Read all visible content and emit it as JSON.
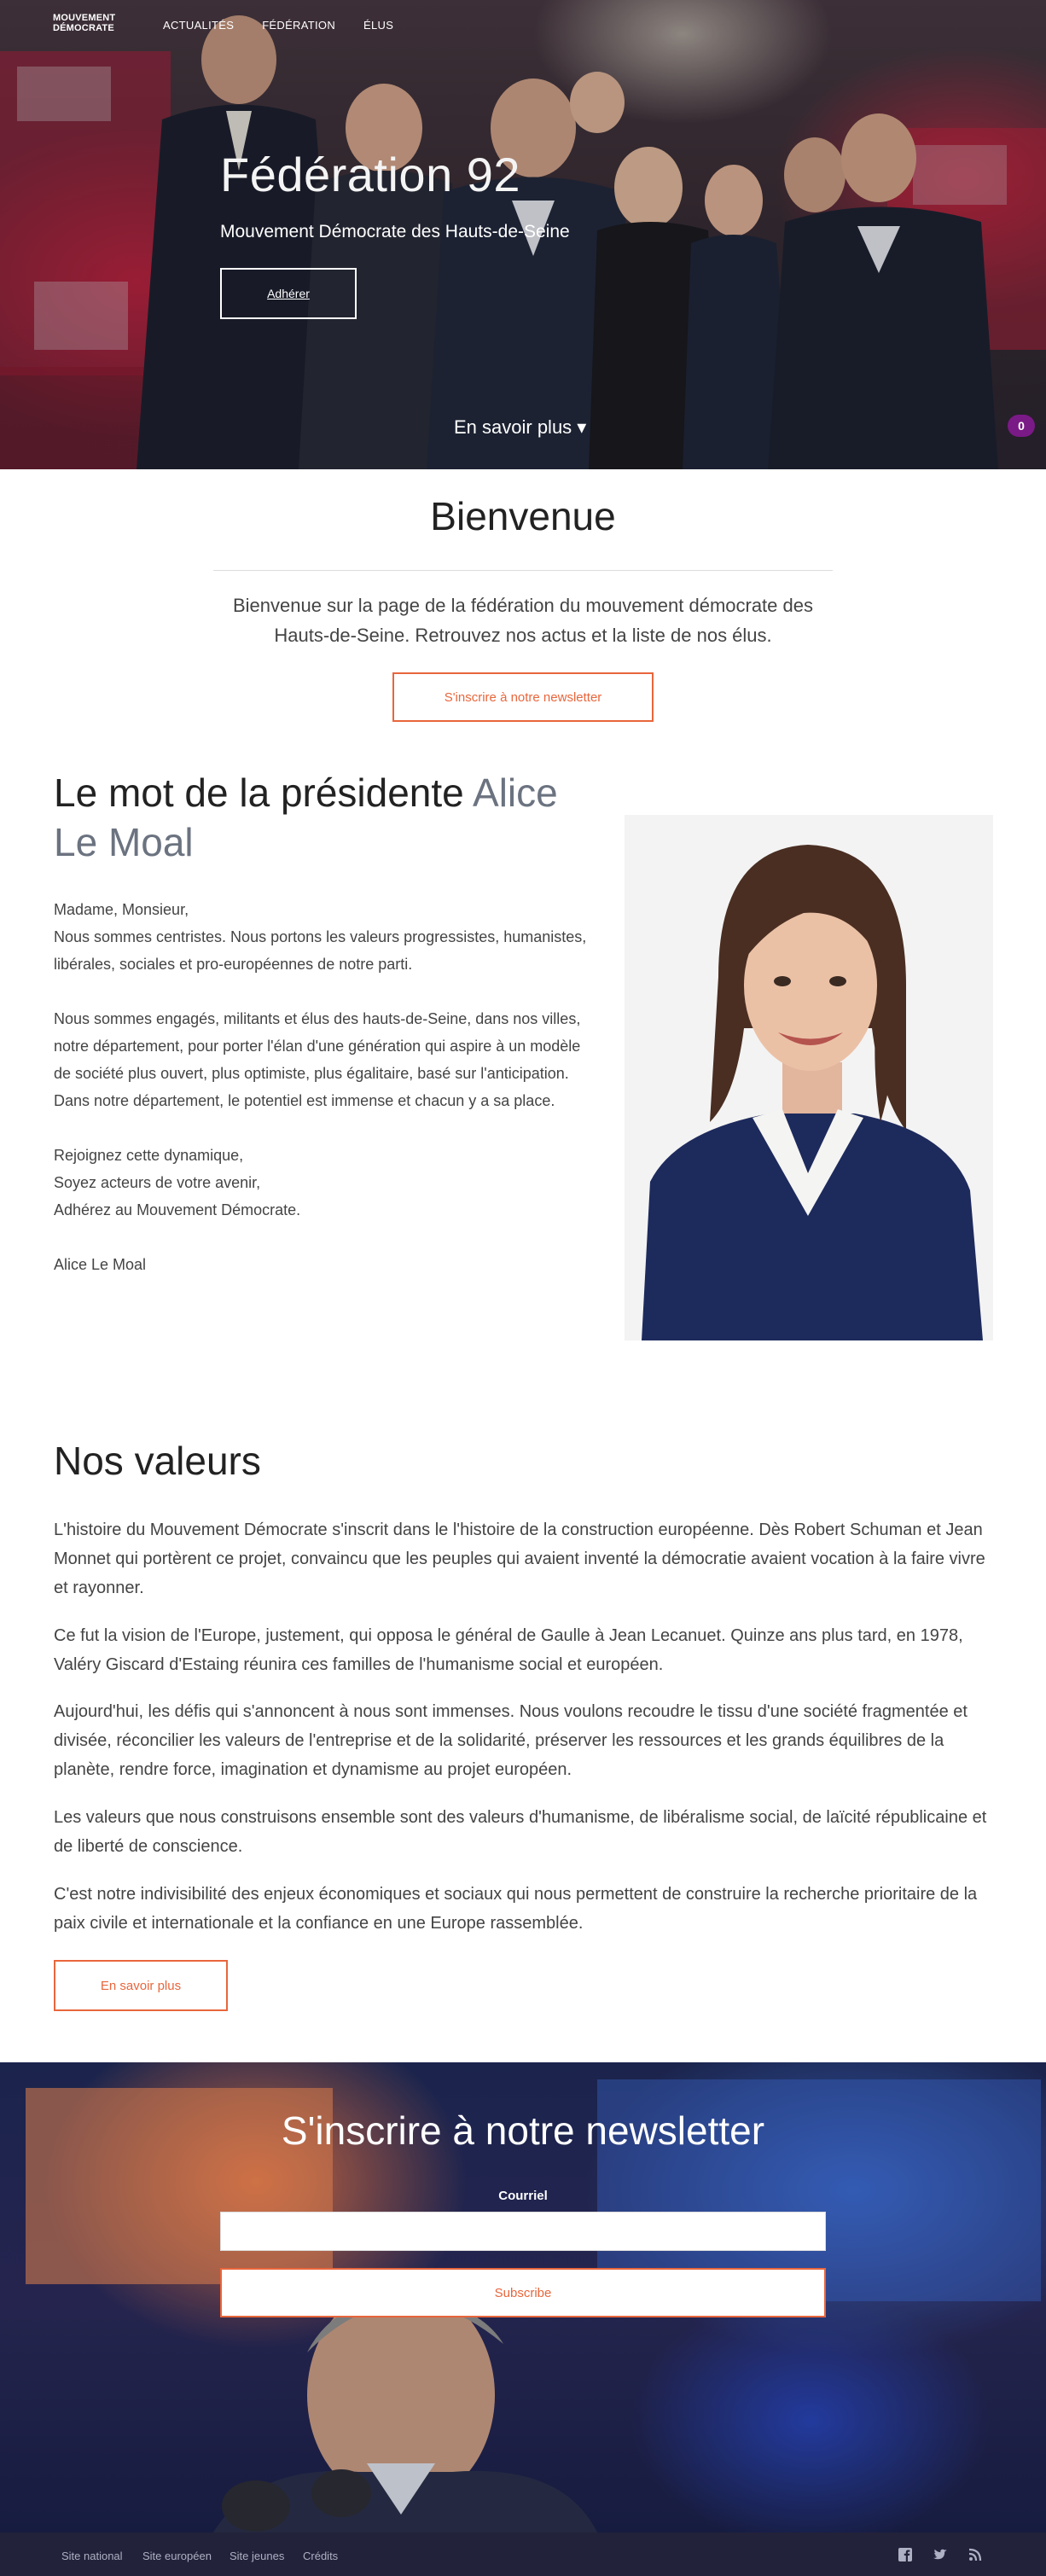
{
  "nav": {
    "logo_line1": "MOUVEMENT",
    "logo_line2": "DÉMOCRATE",
    "items": [
      "ACTUALITÉS",
      "FÉDÉRATION",
      "ÉLUS"
    ]
  },
  "hero": {
    "title": "Fédération 92",
    "subtitle": "Mouvement Démocrate des Hauts-de-Seine",
    "join_button": "Adhérer",
    "more_link": "En savoir plus ▾",
    "badge_count": "0"
  },
  "welcome": {
    "title": "Bienvenue",
    "text": "Bienvenue sur la page de la fédération du mouvement démocrate des Hauts-de-Seine. Retrouvez nos actus et la liste de nos élus.",
    "newsletter_button": "S'inscrire à notre newsletter"
  },
  "president": {
    "title_prefix": "Le mot de la présidente",
    "title_name": "Alice Le Moal",
    "text": "Madame, Monsieur,\nNous sommes centristes. Nous portons les valeurs progressistes, humanistes, libérales, sociales et pro-européennes de notre parti.\n\nNous sommes engagés, militants et élus des hauts-de-Seine, dans nos villes, notre département, pour porter l'élan d'une génération qui aspire à un modèle de société plus ouvert, plus optimiste, plus égalitaire, basé sur l'anticipation. Dans notre département, le potentiel est immense et chacun y a sa place.\n\nRejoignez cette dynamique,\nSoyez acteurs de votre avenir,\nAdhérez au Mouvement Démocrate.\n\nAlice Le Moal"
  },
  "values": {
    "title": "Nos valeurs",
    "paragraphs": [
      "L'histoire du Mouvement Démocrate s'inscrit dans le l'histoire de la construction européenne. Dès Robert Schuman et Jean Monnet qui portèrent ce projet, convaincu que les peuples qui avaient inventé la démocratie avaient vocation à la faire vivre et rayonner.",
      "Ce fut la vision de l'Europe, justement, qui opposa le général de Gaulle à Jean Lecanuet. Quinze ans plus tard, en 1978, Valéry Giscard d'Estaing réunira ces familles de l'humanisme social et européen.",
      "Aujourd'hui, les défis qui s'annoncent à nous sont immenses. Nous voulons recoudre le tissu d'une société fragmentée et divisée, réconcilier les valeurs de l'entreprise et de la solidarité, préserver les ressources et les grands équilibres de la planète, rendre force, imagination et dynamisme au projet européen.",
      "Les valeurs que nous construisons ensemble sont des valeurs d'humanisme, de libéralisme social, de laïcité républicaine et de liberté de conscience.",
      "C'est notre indivisibilité des enjeux économiques et sociaux qui nous permettent de construire la recherche prioritaire de la paix civile et internationale et la confiance en une Europe rassemblée."
    ],
    "more_button": "En savoir plus"
  },
  "newsletter": {
    "title": "S'inscrire à notre newsletter",
    "email_label": "Courriel",
    "email_value": "",
    "subscribe_button": "Subscribe"
  },
  "footer": {
    "links": [
      "Site national",
      "Site européen",
      "Site jeunes",
      "Crédits"
    ],
    "social_icons": [
      "facebook-icon",
      "twitter-icon",
      "rss-icon"
    ]
  },
  "colors": {
    "accent": "#e8663c",
    "footer_bg": "#22223a",
    "badge": "#7a1a86"
  }
}
